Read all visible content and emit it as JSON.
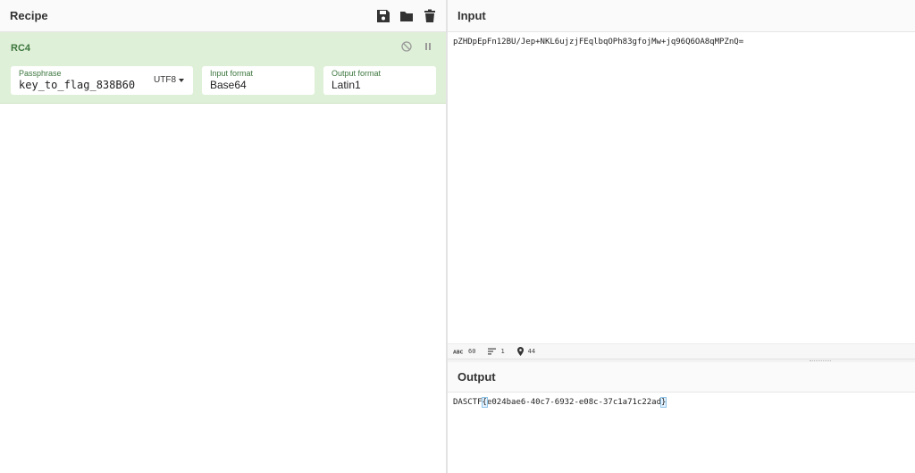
{
  "recipe": {
    "title": "Recipe",
    "icons": [
      "save-icon",
      "folder-icon",
      "trash-icon"
    ],
    "operation": {
      "name": "RC4",
      "passphrase_label": "Passphrase",
      "passphrase_value": "key_to_flag_838B60…",
      "encoding": "UTF8",
      "input_format_label": "Input format",
      "input_format_value": "Base64",
      "output_format_label": "Output format",
      "output_format_value": "Latin1"
    }
  },
  "input": {
    "title": "Input",
    "text": "pZHDpEpFn12BU/Jep+NKL6ujzjFEqlbqOPh83gfojMw+jq96Q6OA8qMPZnQ=",
    "stats": {
      "length": "60",
      "lines": "1",
      "position": "44"
    }
  },
  "output": {
    "title": "Output",
    "prefix": "DASCTF",
    "open_brace": "{",
    "body": "e024bae6-40c7-6932-e08c-37c1a71c22ad",
    "close_brace": "}"
  },
  "colors": {
    "accent_green": "#3c763d",
    "operation_bg": "#dff0d8"
  }
}
